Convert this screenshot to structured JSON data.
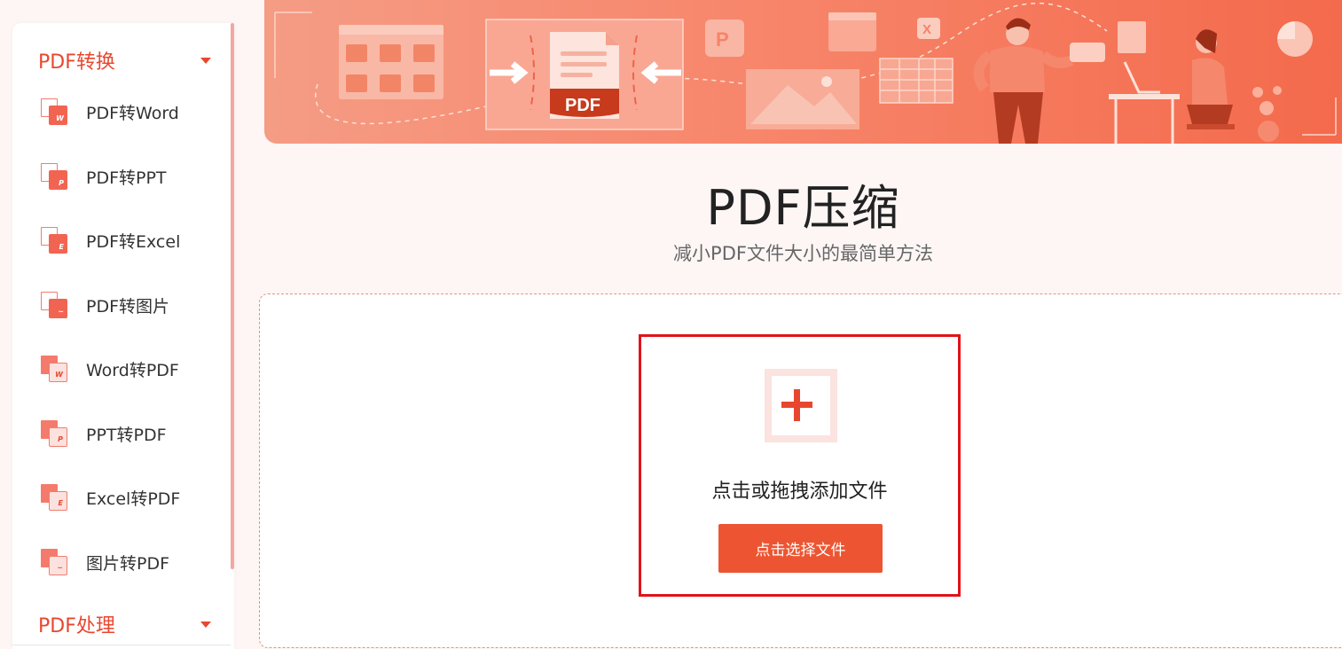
{
  "sidebar": {
    "groups": [
      {
        "label": "PDF转换"
      },
      {
        "label": "PDF处理"
      }
    ],
    "items": [
      {
        "label": "PDF转Word",
        "icon": "pdf-to-word-icon",
        "badge": "W"
      },
      {
        "label": "PDF转PPT",
        "icon": "pdf-to-ppt-icon",
        "badge": "P"
      },
      {
        "label": "PDF转Excel",
        "icon": "pdf-to-excel-icon",
        "badge": "E"
      },
      {
        "label": "PDF转图片",
        "icon": "pdf-to-image-icon",
        "badge": "~"
      },
      {
        "label": "Word转PDF",
        "icon": "word-to-pdf-icon",
        "badge": "W"
      },
      {
        "label": "PPT转PDF",
        "icon": "ppt-to-pdf-icon",
        "badge": "P"
      },
      {
        "label": "Excel转PDF",
        "icon": "excel-to-pdf-icon",
        "badge": "E"
      },
      {
        "label": "图片转PDF",
        "icon": "image-to-pdf-icon",
        "badge": "~"
      }
    ]
  },
  "banner": {
    "badge_text": "PDF",
    "icon_letters": [
      "P",
      "X"
    ]
  },
  "main": {
    "title": "PDF压缩",
    "subtitle": "减小PDF文件大小的最简单方法",
    "upload": {
      "drop_text": "点击或拖拽添加文件",
      "button_label": "点击选择文件"
    }
  },
  "colors": {
    "accent": "#e8472f",
    "button": "#ed5532",
    "highlight": "#e0131b",
    "background": "#fdf6f5"
  }
}
